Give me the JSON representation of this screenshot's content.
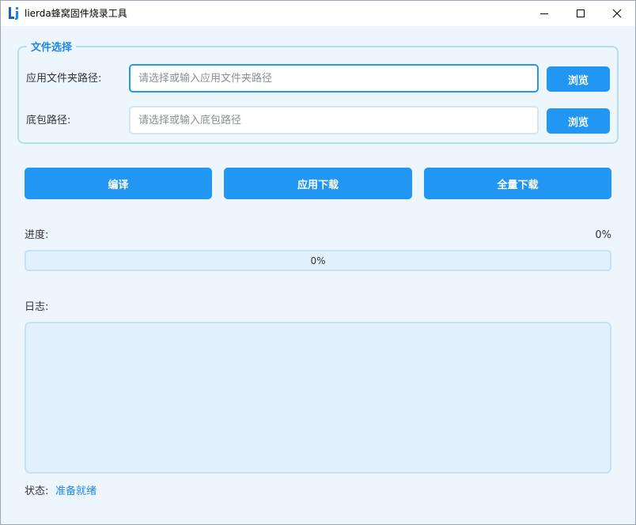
{
  "window": {
    "title": "lierda蜂窝固件烧录工具",
    "minimize_icon": "minimize-icon",
    "maximize_icon": "maximize-icon",
    "close_icon": "close-icon"
  },
  "file_selection": {
    "legend": "文件选择",
    "app_folder": {
      "label": "应用文件夹路径:",
      "value": "",
      "placeholder": "请选择或输入应用文件夹路径",
      "browse_label": "浏览"
    },
    "base_package": {
      "label": "底包路径:",
      "value": "",
      "placeholder": "请选择或输入底包路径",
      "browse_label": "浏览"
    }
  },
  "actions": {
    "compile_label": "编译",
    "app_download_label": "应用下载",
    "full_download_label": "全量下载"
  },
  "progress": {
    "label": "进度:",
    "percent_text": "0%",
    "bar_text": "0%",
    "fraction": 0
  },
  "log": {
    "label": "日志:",
    "content": ""
  },
  "status": {
    "label": "状态:",
    "value": "准备就绪"
  },
  "colors": {
    "accent": "#2196f3",
    "background": "#eef6fd",
    "status_text": "#1e88e5"
  }
}
